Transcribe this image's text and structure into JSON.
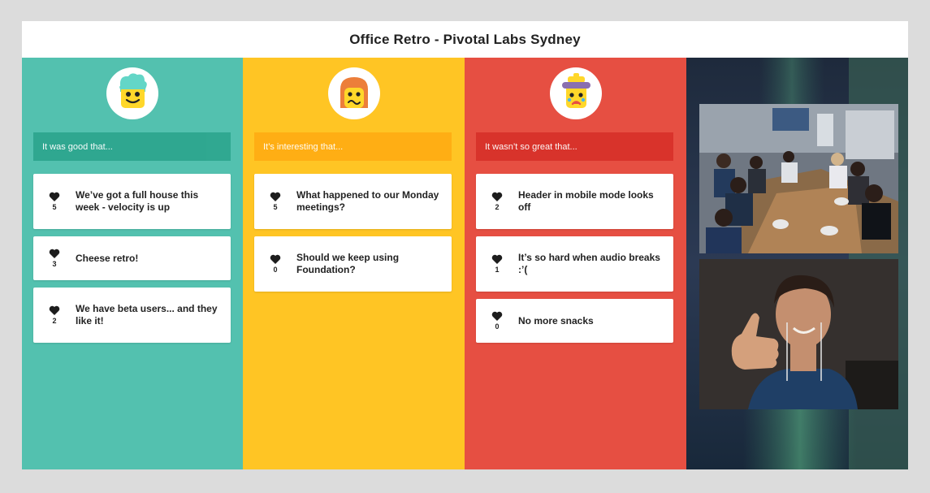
{
  "header": {
    "title": "Office Retro - Pivotal Labs Sydney"
  },
  "colors": {
    "happy": "#53c1af",
    "happy_prompt": "#2ea68f",
    "meh": "#ffc524",
    "meh_prompt": "#ffad14",
    "sad": "#e64f42",
    "sad_prompt": "#d8322a"
  },
  "columns": [
    {
      "id": "happy",
      "avatar_icon": "happy-face-icon",
      "prompt": "It was good that...",
      "items": [
        {
          "votes": "5",
          "text": "We’ve got a full house this week - velocity is up"
        },
        {
          "votes": "3",
          "text": "Cheese retro!"
        },
        {
          "votes": "2",
          "text": "We have beta users... and they like it!"
        }
      ]
    },
    {
      "id": "meh",
      "avatar_icon": "neutral-face-icon",
      "prompt": "It’s interesting that...",
      "items": [
        {
          "votes": "5",
          "text": "What happened to our Monday meetings?"
        },
        {
          "votes": "0",
          "text": "Should we keep using Foundation?"
        }
      ]
    },
    {
      "id": "sad",
      "avatar_icon": "sad-face-icon",
      "prompt": "It wasn’t so great that...",
      "items": [
        {
          "votes": "2",
          "text": "Header in mobile mode looks off"
        },
        {
          "votes": "1",
          "text": "It’s so hard when audio breaks :’("
        },
        {
          "votes": "0",
          "text": "No more snacks"
        }
      ]
    }
  ],
  "video": {
    "feeds": [
      "meeting-room-feed",
      "participant-thumbs-up-feed"
    ]
  }
}
